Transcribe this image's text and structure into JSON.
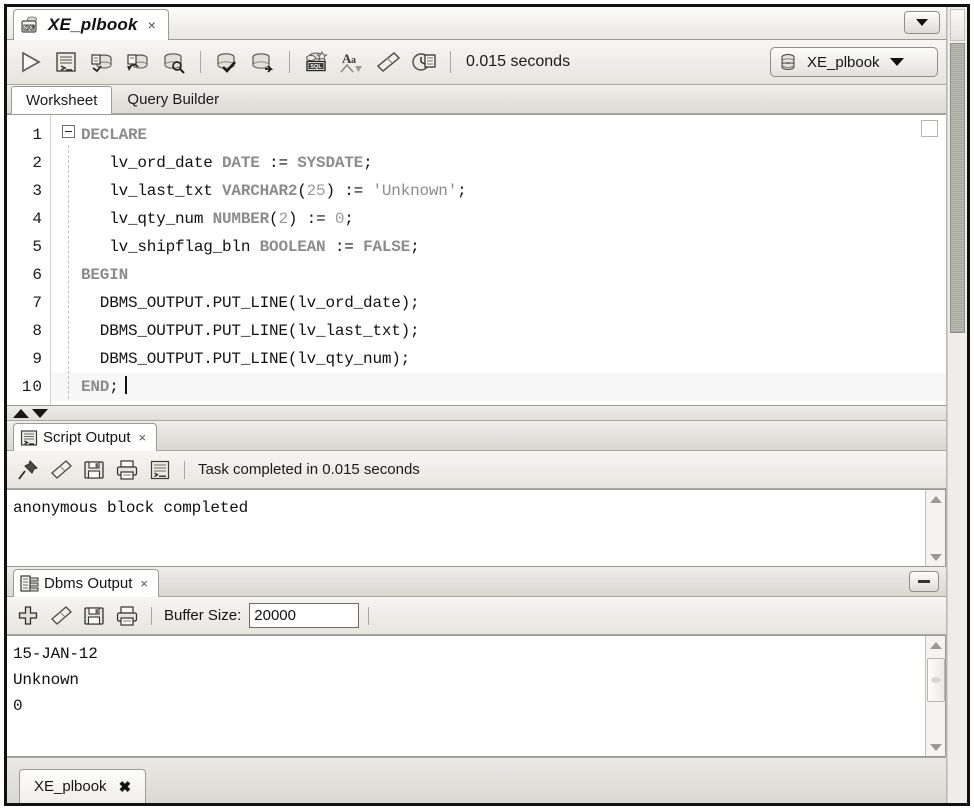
{
  "worksheet_tab": {
    "title": "XE_plbook",
    "close_label": "×",
    "icon": "sql-worksheet-icon",
    "dropdown_icon": "chevron-down-icon"
  },
  "toolbar": {
    "buttons": [
      {
        "name": "run-statement-button",
        "icon": "play-triangle-icon",
        "tooltip": "Run Statement"
      },
      {
        "name": "run-script-button",
        "icon": "script-sheet-icon",
        "tooltip": "Run Script"
      },
      {
        "name": "commit-button",
        "icon": "db-commit-icon",
        "tooltip": "Commit"
      },
      {
        "name": "rollback-button",
        "icon": "db-rollback-icon",
        "tooltip": "Rollback"
      },
      {
        "name": "unshared-sql-worksheet-button",
        "icon": "db-magnifier-icon",
        "tooltip": "Unshared SQL Worksheet"
      },
      {
        "name": "autotrace-button",
        "icon": "db-check-icon",
        "tooltip": "Autotrace"
      },
      {
        "name": "explain-plan-button",
        "icon": "db-arrow-icon",
        "tooltip": "Explain Plan"
      },
      {
        "name": "sql-history-button",
        "icon": "sql-star-icon",
        "tooltip": "SQL History"
      },
      {
        "name": "format-sql-button",
        "icon": "aa-format-icon",
        "tooltip": "Format SQL"
      },
      {
        "name": "clear-button",
        "icon": "eraser-icon",
        "tooltip": "Clear"
      },
      {
        "name": "query-history-button",
        "icon": "clock-sheet-icon",
        "tooltip": "Query History"
      }
    ],
    "elapsed": "0.015 seconds",
    "connection": "XE_plbook",
    "connection_icon": "database-icon",
    "connection_caret": "chevron-down-icon"
  },
  "subtabs": [
    {
      "name": "tab-worksheet",
      "label": "Worksheet",
      "active": true
    },
    {
      "name": "tab-query-builder",
      "label": "Query Builder",
      "active": false
    }
  ],
  "editor": {
    "fold_icon": "collapse-minus-icon",
    "lines": [
      {
        "num": "1",
        "tokens": [
          {
            "t": "DECLARE",
            "c": "kw"
          }
        ]
      },
      {
        "num": "2",
        "tokens": [
          {
            "t": "   lv_ord_date ",
            "c": "plain"
          },
          {
            "t": "DATE",
            "c": "kw"
          },
          {
            "t": " := ",
            "c": "plain"
          },
          {
            "t": "SYSDATE",
            "c": "kw"
          },
          {
            "t": ";",
            "c": "plain"
          }
        ]
      },
      {
        "num": "3",
        "tokens": [
          {
            "t": "   lv_last_txt ",
            "c": "plain"
          },
          {
            "t": "VARCHAR2",
            "c": "kw"
          },
          {
            "t": "(",
            "c": "plain"
          },
          {
            "t": "25",
            "c": "num"
          },
          {
            "t": ") := ",
            "c": "plain"
          },
          {
            "t": "'Unknown'",
            "c": "str"
          },
          {
            "t": ";",
            "c": "plain"
          }
        ]
      },
      {
        "num": "4",
        "tokens": [
          {
            "t": "   lv_qty_num ",
            "c": "plain"
          },
          {
            "t": "NUMBER",
            "c": "kw"
          },
          {
            "t": "(",
            "c": "plain"
          },
          {
            "t": "2",
            "c": "num"
          },
          {
            "t": ") := ",
            "c": "plain"
          },
          {
            "t": "0",
            "c": "num"
          },
          {
            "t": ";",
            "c": "plain"
          }
        ]
      },
      {
        "num": "5",
        "tokens": [
          {
            "t": "   lv_shipflag_bln ",
            "c": "plain"
          },
          {
            "t": "BOOLEAN",
            "c": "kw"
          },
          {
            "t": " := ",
            "c": "plain"
          },
          {
            "t": "FALSE",
            "c": "kw"
          },
          {
            "t": ";",
            "c": "plain"
          }
        ]
      },
      {
        "num": "6",
        "tokens": [
          {
            "t": "BEGIN",
            "c": "kw"
          }
        ]
      },
      {
        "num": "7",
        "tokens": [
          {
            "t": "  DBMS_OUTPUT.PUT_LINE(lv_ord_date);",
            "c": "plain"
          }
        ]
      },
      {
        "num": "8",
        "tokens": [
          {
            "t": "  DBMS_OUTPUT.PUT_LINE(lv_last_txt);",
            "c": "plain"
          }
        ]
      },
      {
        "num": "9",
        "tokens": [
          {
            "t": "  DBMS_OUTPUT.PUT_LINE(lv_qty_num);",
            "c": "plain"
          }
        ]
      },
      {
        "num": "10",
        "tokens": [
          {
            "t": "END",
            "c": "kw"
          },
          {
            "t": ";",
            "c": "plain"
          }
        ],
        "caret": true
      }
    ]
  },
  "script_output": {
    "tab_label": "Script Output",
    "tab_icon": "script-output-icon",
    "tab_close": "×",
    "buttons": [
      {
        "name": "pin-button",
        "icon": "pin-icon"
      },
      {
        "name": "clear-button",
        "icon": "eraser-icon"
      },
      {
        "name": "save-button",
        "icon": "floppy-save-icon"
      },
      {
        "name": "print-button",
        "icon": "printer-icon"
      },
      {
        "name": "wrap-button",
        "icon": "script-sheet-icon"
      }
    ],
    "status": "Task completed in 0.015 seconds",
    "lines": [
      "anonymous block completed"
    ],
    "scroll_up_icon": "chevron-up-icon",
    "scroll_down_icon": "chevron-down-icon"
  },
  "dbms_output": {
    "tab_label": "Dbms Output",
    "tab_icon": "dbms-output-icon",
    "tab_close": "×",
    "minimize_icon": "minimize-icon",
    "buttons": [
      {
        "name": "add-connection-button",
        "icon": "plus-icon"
      },
      {
        "name": "clear-button",
        "icon": "eraser-icon"
      },
      {
        "name": "save-button",
        "icon": "floppy-save-icon"
      },
      {
        "name": "print-button",
        "icon": "printer-icon"
      }
    ],
    "buffer_label": "Buffer Size:",
    "buffer_value": "20000",
    "lines": [
      "15-JAN-12",
      "Unknown",
      "0"
    ],
    "scroll_up_icon": "chevron-up-icon",
    "scroll_down_icon": "chevron-down-icon"
  },
  "bottom_bar": {
    "tab_label": "XE_plbook",
    "tab_close": "✖"
  },
  "colors": {
    "keyword": "#8c8c8c",
    "literal": "#9a9a9a",
    "text": "#111111",
    "panel_bg": "#f2f1ef",
    "border": "#9a9a95"
  }
}
